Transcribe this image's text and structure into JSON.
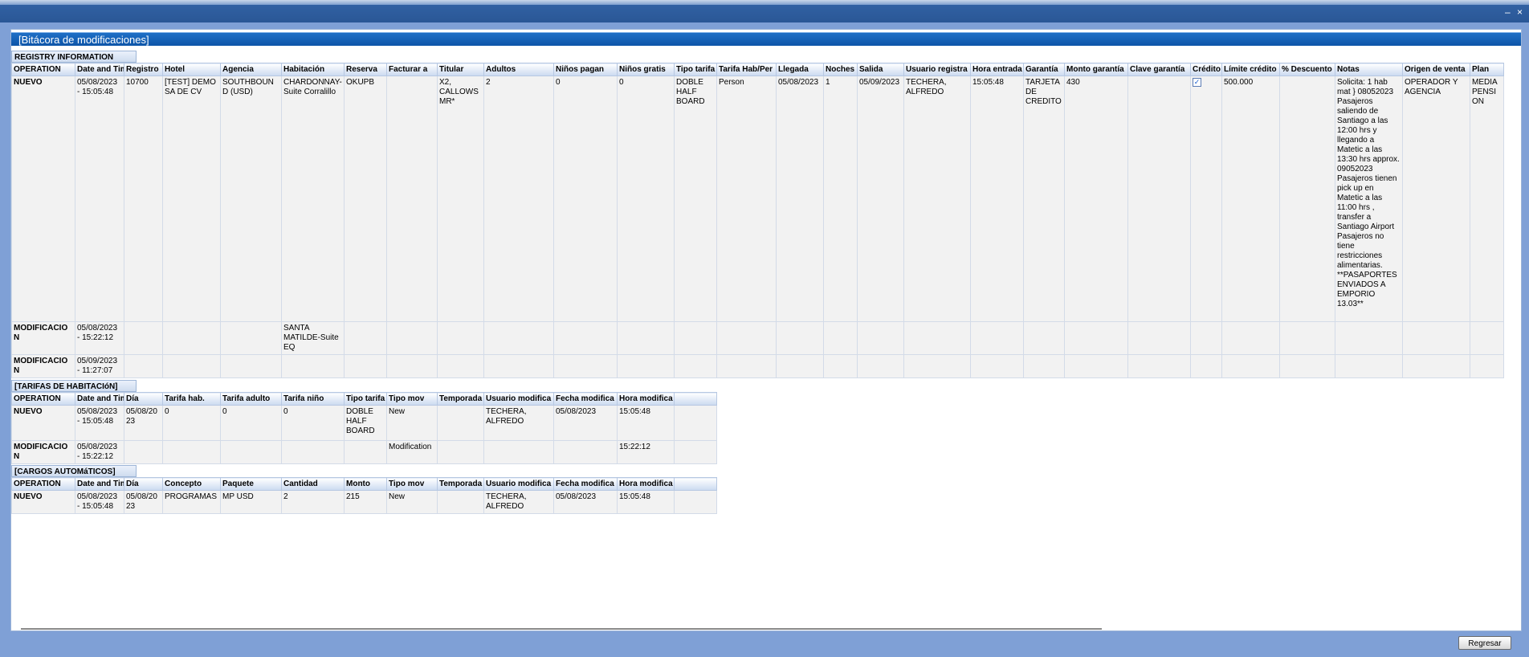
{
  "dialog_title": "[Bitácora de modificaciones]",
  "window_controls": {
    "minimize": "–",
    "close": "×"
  },
  "registry": {
    "label": "REGISTRY INFORMATION",
    "columns": [
      "OPERATION",
      "Date and Time",
      "Registro",
      "Hotel",
      "Agencia",
      "Habitación",
      "Reserva",
      "Facturar a",
      "Titular",
      "Adultos",
      "Niños pagan",
      "Niños gratis",
      "Tipo tarifa",
      "Tarifa Hab/Per",
      "Llegada",
      "Noches",
      "Salida",
      "Usuario registra",
      "Hora entrada",
      "Garantía",
      "Monto garantía",
      "Clave garantía",
      "Crédito",
      "Límite crédito",
      "% Descuento",
      "Notas",
      "Origen de venta",
      "Plan"
    ],
    "rows": [
      [
        "NUEVO",
        "05/08/2023 - 15:05:48",
        "10700",
        "[TEST] DEMO SA DE CV",
        "SOUTHBOUND (USD)",
        "CHARDONNAY-Suite Corralillo",
        "OKUPB",
        "",
        "X2, CALLOWS MR*",
        "2",
        "0",
        "0",
        "DOBLE HALF BOARD",
        "Person",
        "05/08/2023",
        "1",
        "05/09/2023",
        "TECHERA, ALFREDO",
        "15:05:48",
        "TARJETA DE CREDITO",
        "430",
        "",
        "✓",
        "500.000",
        "",
        "Solicita: 1 hab mat } 08052023 Pasajeros saliendo de Santiago a las 12:00 hrs y llegando a Matetic a las 13:30 hrs approx. 09052023 Pasajeros tienen pick up en Matetic a las 11:00 hrs , transfer a Santiago Airport Pasajeros no tiene restricciones alimentarias. **PASAPORTES ENVIADOS A EMPORIO 13.03**",
        "OPERADOR Y AGENCIA",
        "MEDIA PENSION"
      ],
      [
        "MODIFICACION",
        "05/08/2023 - 15:22:12",
        "",
        "",
        "",
        "SANTA MATILDE-Suite EQ",
        "",
        "",
        "",
        "",
        "",
        "",
        "",
        "",
        "",
        "",
        "",
        "",
        "",
        "",
        "",
        "",
        "",
        "",
        "",
        "",
        "",
        ""
      ],
      [
        "MODIFICACION",
        "05/09/2023 - 11:27:07",
        "",
        "",
        "",
        "",
        "",
        "",
        "",
        "",
        "",
        "",
        "",
        "",
        "",
        "",
        "",
        "",
        "",
        "",
        "",
        "",
        "",
        "",
        "",
        "",
        "",
        ""
      ]
    ]
  },
  "tarifas": {
    "label": "[TARIFAS DE HABITACIóN]",
    "columns": [
      "OPERATION",
      "Date and Time",
      "Día",
      "Tarifa hab.",
      "Tarifa adulto",
      "Tarifa niño",
      "Tipo tarifa",
      "Tipo mov",
      "Temporada",
      "Usuario modifica",
      "Fecha modifica",
      "Hora modifica",
      ""
    ],
    "rows": [
      [
        "NUEVO",
        "05/08/2023 - 15:05:48",
        "05/08/2023",
        "0",
        "0",
        "0",
        "DOBLE HALF BOARD",
        "New",
        "",
        "TECHERA, ALFREDO",
        "05/08/2023",
        "15:05:48",
        ""
      ],
      [
        "MODIFICACION",
        "05/08/2023 - 15:22:12",
        "",
        "",
        "",
        "",
        "",
        "Modification",
        "",
        "",
        "",
        "15:22:12",
        ""
      ]
    ]
  },
  "cargos": {
    "label": "[CARGOS AUTOMáTICOS]",
    "columns": [
      "OPERATION",
      "Date and Time",
      "Día",
      "Concepto",
      "Paquete",
      "Cantidad",
      "Monto",
      "Tipo mov",
      "Temporada",
      "Usuario modifica",
      "Fecha modifica",
      "Hora modifica",
      ""
    ],
    "rows": [
      [
        "NUEVO",
        "05/08/2023 - 15:05:48",
        "05/08/2023",
        "PROGRAMAS",
        "MP USD",
        "2",
        "215",
        "New",
        "",
        "TECHERA, ALFREDO",
        "05/08/2023",
        "15:05:48",
        ""
      ]
    ]
  },
  "footer": {
    "back_button": "Regresar"
  }
}
